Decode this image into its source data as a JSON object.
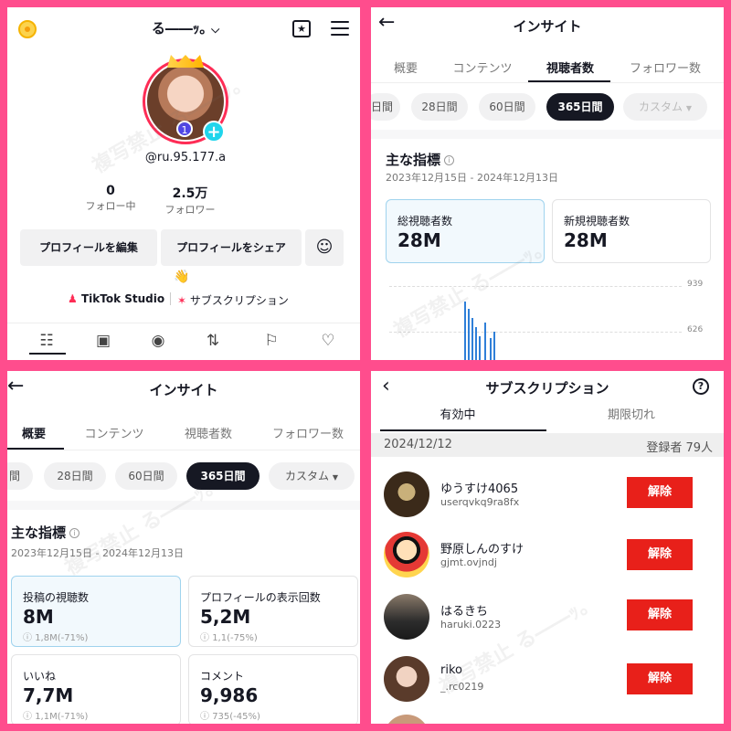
{
  "profile": {
    "display_name": "る――ｯ｡",
    "handle": "@ru.95.177.a",
    "avatar_level": "1",
    "following_count": "0",
    "following_label": "フォロー中",
    "followers_count": "2.5万",
    "followers_label": "フォロワー",
    "edit_button": "プロフィールを編集",
    "share_button": "プロフィールをシェア",
    "wave_emoji": "👋",
    "studio_link": "TikTok Studio",
    "subscription_link": "サブスクリプション",
    "icons": [
      "coin-icon",
      "calendar-star-icon",
      "menu-icon",
      "add-friend-icon",
      "grid-icon",
      "repost-icon",
      "lock-icon",
      "share-icon",
      "saved-icon",
      "liked-icon"
    ]
  },
  "insight_viewers": {
    "title": "インサイト",
    "tabs": [
      "概要",
      "コンテンツ",
      "視聴者数",
      "フォロワー数"
    ],
    "active_tab": "視聴者数",
    "ranges": [
      "日間",
      "28日間",
      "60日間",
      "365日間",
      "カスタム"
    ],
    "active_range": "365日間",
    "section_title": "主な指標",
    "date_range": "2023年12月15日 - 2024年12月13日",
    "cards": [
      {
        "label": "総視聴者数",
        "value": "28M"
      },
      {
        "label": "新規視聴者数",
        "value": "28M"
      }
    ],
    "axis_ticks": [
      "939",
      "626"
    ]
  },
  "insight_overview": {
    "title": "インサイト",
    "tabs": [
      "概要",
      "コンテンツ",
      "視聴者数",
      "フォロワー数"
    ],
    "active_tab": "概要",
    "ranges": [
      "間",
      "28日間",
      "60日間",
      "365日間",
      "カスタム"
    ],
    "active_range": "365日間",
    "section_title": "主な指標",
    "date_range": "2023年12月15日 - 2024年12月13日",
    "cards": [
      {
        "label": "投稿の視聴数",
        "value": "8M",
        "sub": "1,8M(-71%)"
      },
      {
        "label": "プロフィールの表示回数",
        "value": "5,2M",
        "sub": "1,1(-75%)"
      },
      {
        "label": "いいね",
        "value": "7,7M",
        "sub": "1,1M(-71%)"
      },
      {
        "label": "コメント",
        "value": "9,986",
        "sub": "735(-45%)"
      }
    ]
  },
  "subscriptions": {
    "title": "サブスクリプション",
    "help": "?",
    "tabs": [
      "有効中",
      "期限切れ"
    ],
    "active_tab": "有効中",
    "date": "2024/12/12",
    "count_label": "登録者 79人",
    "cancel_label": "解除",
    "rows": [
      {
        "name": "ゆうすけ4065",
        "handle": "userqvkq9ra8fx"
      },
      {
        "name": "野原しんのすけ",
        "handle": "gjmt.ovjndj"
      },
      {
        "name": "はるきち",
        "handle": "haruki.0223"
      },
      {
        "name": "riko",
        "handle": "_.rc0219"
      }
    ]
  },
  "watermark": "複写禁止 る――ｯ｡"
}
